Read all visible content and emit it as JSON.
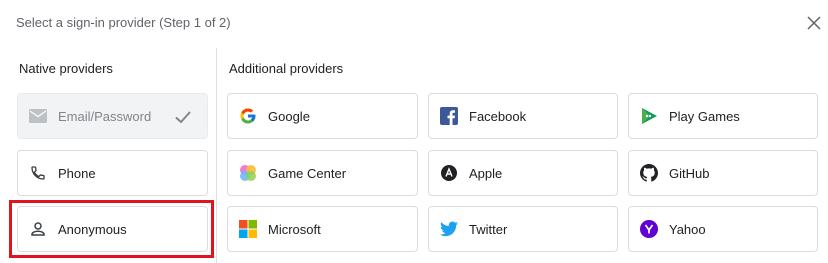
{
  "header": {
    "title": "Select a sign-in provider (Step 1 of 2)"
  },
  "native": {
    "label": "Native providers",
    "items": [
      {
        "label": "Email/Password",
        "icon": "mail-icon",
        "state": "enabled"
      },
      {
        "label": "Phone",
        "icon": "phone-icon"
      },
      {
        "label": "Anonymous",
        "icon": "person-icon"
      }
    ]
  },
  "additional": {
    "label": "Additional providers",
    "items": [
      {
        "label": "Google",
        "icon": "google-icon"
      },
      {
        "label": "Facebook",
        "icon": "facebook-icon"
      },
      {
        "label": "Play Games",
        "icon": "play-games-icon"
      },
      {
        "label": "Game Center",
        "icon": "game-center-icon"
      },
      {
        "label": "Apple",
        "icon": "apple-icon"
      },
      {
        "label": "GitHub",
        "icon": "github-icon"
      },
      {
        "label": "Microsoft",
        "icon": "microsoft-icon"
      },
      {
        "label": "Twitter",
        "icon": "twitter-icon"
      },
      {
        "label": "Yahoo",
        "icon": "yahoo-icon"
      }
    ]
  },
  "colors": {
    "highlight": "#e0141e",
    "facebook": "#3b5998",
    "twitter": "#1da1f2",
    "yahoo": "#5f01d1"
  }
}
